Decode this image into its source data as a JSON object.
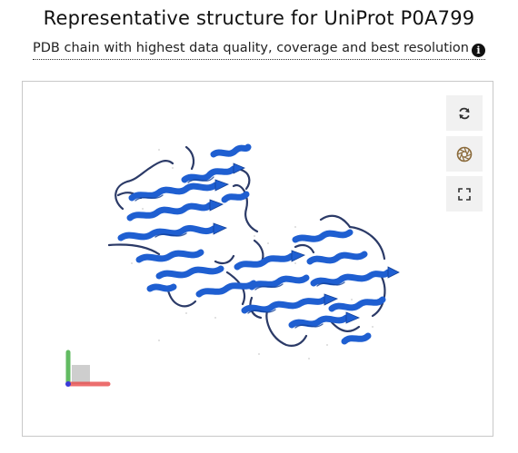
{
  "header": {
    "title": "Representative structure for UniProt P0A799",
    "subtitle": "PDB chain with highest data quality, coverage and best resolution",
    "info_icon": "info-circle-icon"
  },
  "viewer": {
    "controls": [
      {
        "name": "reset-view-button",
        "icon": "refresh-icon"
      },
      {
        "name": "screenshot-button",
        "icon": "camera-shutter-icon"
      },
      {
        "name": "fullscreen-button",
        "icon": "expand-icon"
      }
    ],
    "colors": {
      "cartoon": "#1f5fd1",
      "cartoon_dark": "#123f96",
      "loop": "#2b3a67",
      "control_bg": "#f1f1f1",
      "control_icon": "#333333",
      "shutter_icon": "#8a6a3a",
      "axis_x": "#e84a4a",
      "axis_y": "#3cab3c",
      "axis_z": "#3a3ad8"
    }
  }
}
